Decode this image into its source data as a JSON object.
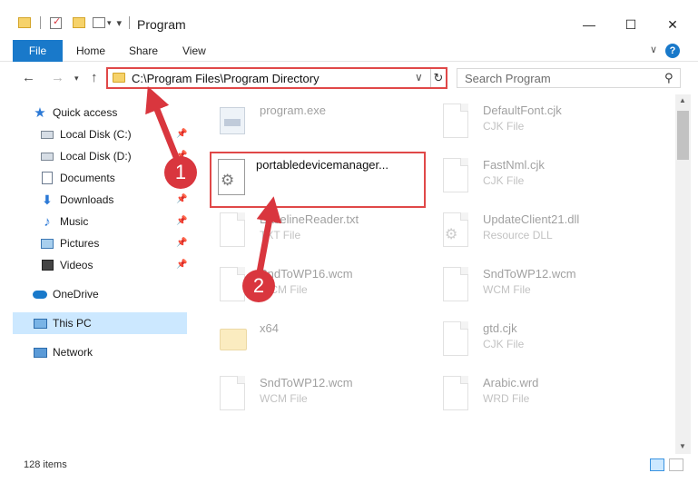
{
  "window": {
    "title": "Program",
    "minimize": "—",
    "maximize": "☐",
    "close": "✕"
  },
  "ribbon": {
    "file": "File",
    "tabs": [
      "Home",
      "Share",
      "View"
    ],
    "help": "?"
  },
  "address": {
    "path": "C:\\Program Files\\Program Directory"
  },
  "search": {
    "placeholder": "Search Program"
  },
  "sidebar": {
    "items": [
      {
        "label": "Quick access"
      },
      {
        "label": "Local Disk (C:)"
      },
      {
        "label": "Local Disk (D:)"
      },
      {
        "label": "Documents"
      },
      {
        "label": "Downloads"
      },
      {
        "label": "Music"
      },
      {
        "label": "Pictures"
      },
      {
        "label": "Videos"
      },
      {
        "label": "OneDrive"
      },
      {
        "label": "This PC"
      },
      {
        "label": "Network"
      }
    ]
  },
  "files": {
    "col1": [
      {
        "name": "program.exe",
        "type": ""
      },
      {
        "name": "portabledevicemanager...",
        "type": ""
      },
      {
        "name": "BaselineReader.txt",
        "type": "TXT File"
      },
      {
        "name": "SndToWP16.wcm",
        "type": "WCM File"
      },
      {
        "name": "x64",
        "type": ""
      },
      {
        "name": "SndToWP12.wcm",
        "type": "WCM File"
      }
    ],
    "col2": [
      {
        "name": "DefaultFont.cjk",
        "type": "CJK File"
      },
      {
        "name": "FastNml.cjk",
        "type": "CJK File"
      },
      {
        "name": "UpdateClient21.dll",
        "type": "Resource DLL"
      },
      {
        "name": "SndToWP12.wcm",
        "type": "WCM File"
      },
      {
        "name": "gtd.cjk",
        "type": "CJK File"
      },
      {
        "name": "Arabic.wrd",
        "type": "WRD File"
      }
    ]
  },
  "status": {
    "count": "128 items"
  },
  "annotations": {
    "badge1": "1",
    "badge2": "2",
    "color": "#d9363e"
  }
}
